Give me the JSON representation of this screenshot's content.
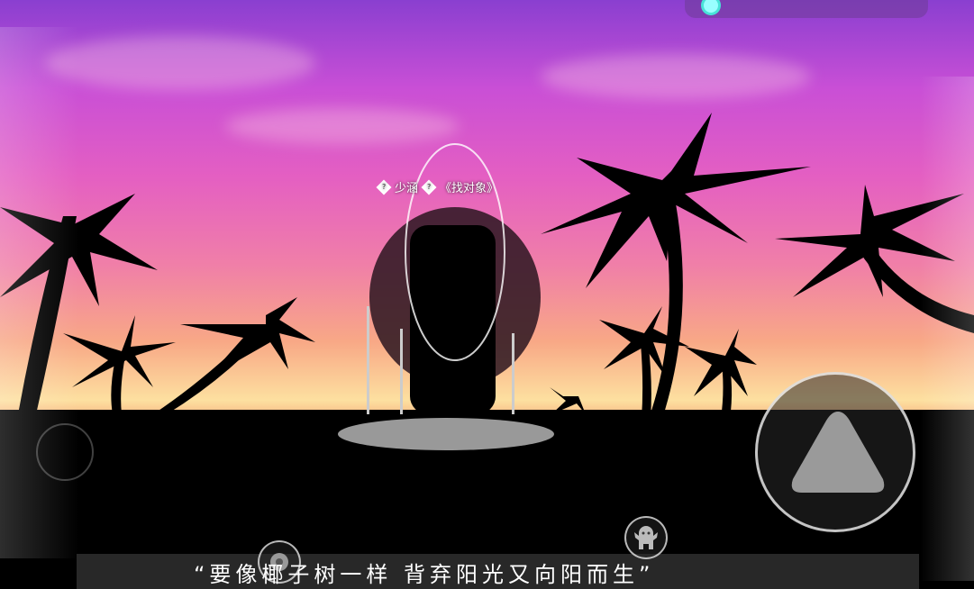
{
  "player": {
    "name": "少涵",
    "title": "《找对象》",
    "badge_icon": "?"
  },
  "caption": "“要像椰子树一样  背弃阳光又向阳而生”",
  "controls": {
    "jump": "jump-button",
    "emote_left": "flower-emote",
    "emote_right": "ghost-emote"
  },
  "colors": {
    "sky_top": "#8a3fd0",
    "sky_mid": "#e45fc2",
    "horizon": "#fde0a0",
    "accent": "#48e3d8"
  }
}
